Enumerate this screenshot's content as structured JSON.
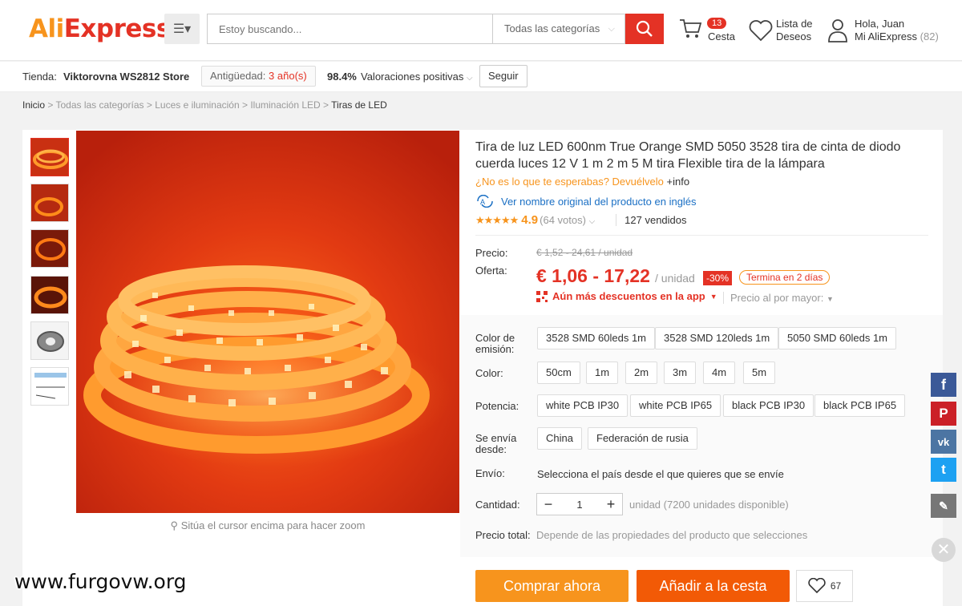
{
  "header": {
    "logo": {
      "part1": "Ali",
      "part2": "Express"
    },
    "search_placeholder": "Estoy buscando...",
    "category": "Todas las categorías",
    "cart": {
      "count": "13",
      "label": "Cesta"
    },
    "wishlist": {
      "line1": "Lista de",
      "line2": "Deseos"
    },
    "user": {
      "greeting": "Hola, Juan",
      "account": "Mi AliExpress",
      "count": "(82)"
    }
  },
  "store": {
    "label": "Tienda:",
    "name": "Viktorovna WS2812 Store",
    "seniority_label": "Antigüedad:",
    "seniority_value": "3 año(s)",
    "rating_pct": "98.4%",
    "rating_label": "Valoraciones positivas",
    "follow": "Seguir"
  },
  "breadcrumb": [
    "Inicio",
    "Todas las categorías",
    "Luces e iluminación",
    "Iluminación LED",
    "Tiras de LED"
  ],
  "product": {
    "title": "Tira de luz LED 600nm True Orange SMD 5050 3528 tira de cinta de diodo cuerda luces 12 V 1 m 2 m 5 M tira Flexible tira de la lámpara",
    "return_text": "¿No es lo que te esperabas? Devuélvelo",
    "return_info": "+info",
    "translate": "Ver nombre original del producto en inglés",
    "stars": "★★★★★",
    "rating": "4.9",
    "votes": "(64 votos)",
    "sold": "127 vendidos",
    "zoom_hint": "Sitúa el cursor encima para hacer zoom"
  },
  "price": {
    "price_label": "Precio:",
    "old": "€ 1,52 - 24,61 / unidad",
    "offer_label": "Oferta:",
    "offer": "€ 1,06 - 17,22",
    "unit": "/ unidad",
    "discount": "-30%",
    "ends": "Termina en 2 días",
    "app": "Aún más descuentos en la app",
    "wholesale": "Precio al por mayor:"
  },
  "options": {
    "color_emision_label": "Color de emisión:",
    "color_emision": [
      "3528 SMD 60leds 1m",
      "3528 SMD 120leds 1m",
      "5050 SMD 60leds 1m"
    ],
    "color_label": "Color:",
    "color": [
      "50cm",
      "1m",
      "2m",
      "3m",
      "4m",
      "5m"
    ],
    "potencia_label": "Potencia:",
    "potencia": [
      "white PCB IP30",
      "white PCB IP65",
      "black PCB IP30",
      "black PCB IP65"
    ],
    "ship_from_label": "Se envía desde:",
    "ship_from": [
      "China",
      "Federación de rusia"
    ],
    "envio_label": "Envío:",
    "envio_text": "Selecciona el país desde el que quieres que se envíe",
    "qty_label": "Cantidad:",
    "qty_value": "1",
    "qty_note": "unidad (7200 unidades disponible)",
    "total_label": "Precio total:",
    "total_text": "Depende de las propiedades del producto que selecciones"
  },
  "actions": {
    "buy": "Comprar ahora",
    "add": "Añadir a la cesta",
    "wish_count": "67"
  },
  "share": {
    "facebook": "f",
    "pinterest": "P",
    "vk": "vk",
    "twitter": "t"
  },
  "watermark": "www.furgovw.org",
  "colors": {
    "brand_red": "#e43225",
    "brand_orange": "#f7941d",
    "link_blue": "#1a6fc4"
  }
}
